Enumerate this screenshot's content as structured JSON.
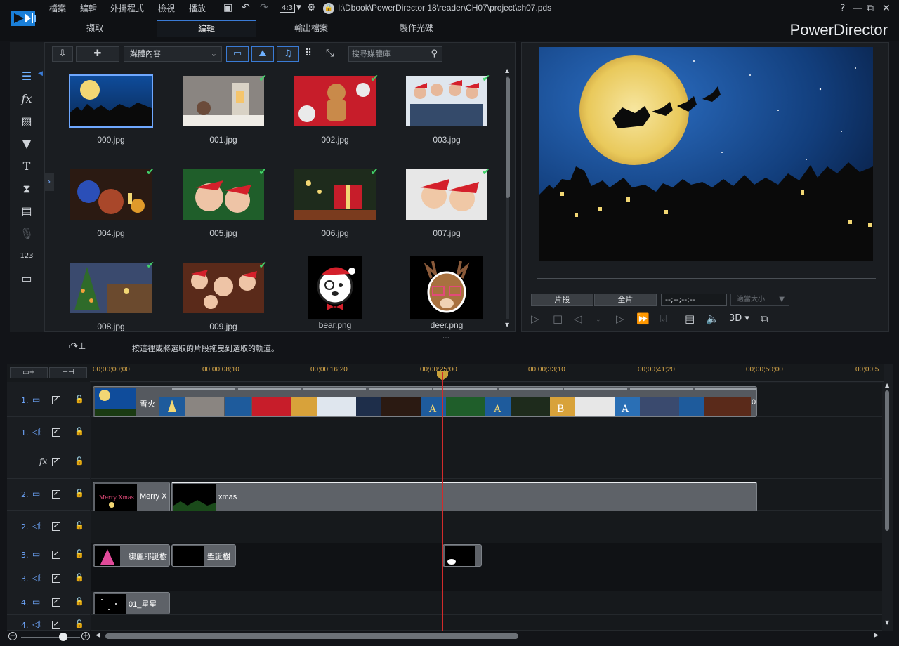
{
  "app": {
    "brand": "PowerDirector",
    "file_path": "I:\\Dbook\\PowerDirector 18\\reader\\CH07\\project\\ch07.pds",
    "menus": [
      "檔案",
      "編輯",
      "外掛程式",
      "檢視",
      "播放"
    ],
    "aspect_ratio": "4:3",
    "mode_tabs": [
      {
        "label": "擷取",
        "active": false
      },
      {
        "label": "編輯",
        "active": true
      },
      {
        "label": "輸出檔案",
        "active": false
      },
      {
        "label": "製作光碟",
        "active": false
      }
    ]
  },
  "library": {
    "filter_select": "媒體內容",
    "search_placeholder": "搜尋媒體庫",
    "items": [
      {
        "name": "000.jpg",
        "selected": true,
        "used": false
      },
      {
        "name": "001.jpg",
        "used": true
      },
      {
        "name": "002.jpg",
        "used": true
      },
      {
        "name": "003.jpg",
        "used": true
      },
      {
        "name": "004.jpg",
        "used": true
      },
      {
        "name": "005.jpg",
        "used": true
      },
      {
        "name": "006.jpg",
        "used": true
      },
      {
        "name": "007.jpg",
        "used": true
      },
      {
        "name": "008.jpg",
        "used": true
      },
      {
        "name": "009.jpg",
        "used": true
      },
      {
        "name": "bear.png",
        "used": false
      },
      {
        "name": "deer.png",
        "used": false
      }
    ]
  },
  "preview": {
    "segment_btn": "片段",
    "full_btn": "全片",
    "timecode": "--;--;--;--",
    "fit_select": "適當大小",
    "mode_3d": "3D"
  },
  "timeline": {
    "drag_hint": "按這裡或將選取的片段拖曳到選取的軌道。",
    "ruler": [
      "00;00;00;00",
      "00;00;08;10",
      "00;00;16;20",
      "00;00;25;00",
      "00;00;33;10",
      "00;00;41;20",
      "00;00;50;00",
      "00;00;5"
    ],
    "tracks": [
      {
        "num": "1.",
        "kind": "video"
      },
      {
        "num": "1.",
        "kind": "audio"
      },
      {
        "num": "",
        "kind": "fx"
      },
      {
        "num": "2.",
        "kind": "video"
      },
      {
        "num": "2.",
        "kind": "audio"
      },
      {
        "num": "3.",
        "kind": "video"
      },
      {
        "num": "3.",
        "kind": "audio"
      },
      {
        "num": "4.",
        "kind": "video"
      },
      {
        "num": "4.",
        "kind": "audio"
      }
    ],
    "clips": {
      "track1_first": "雪火",
      "track2_a": "Merry X",
      "track2_b": "xmas",
      "track3_a": "綁麗耶誕樹",
      "track3_b": "聖誕樹",
      "track4_a": "01_星星",
      "track1_last": "0"
    }
  },
  "colors": {
    "accent": "#3a7bd5",
    "ruler_text": "#d8a84a",
    "playhead": "#d12b2b",
    "check": "#42d26b"
  }
}
